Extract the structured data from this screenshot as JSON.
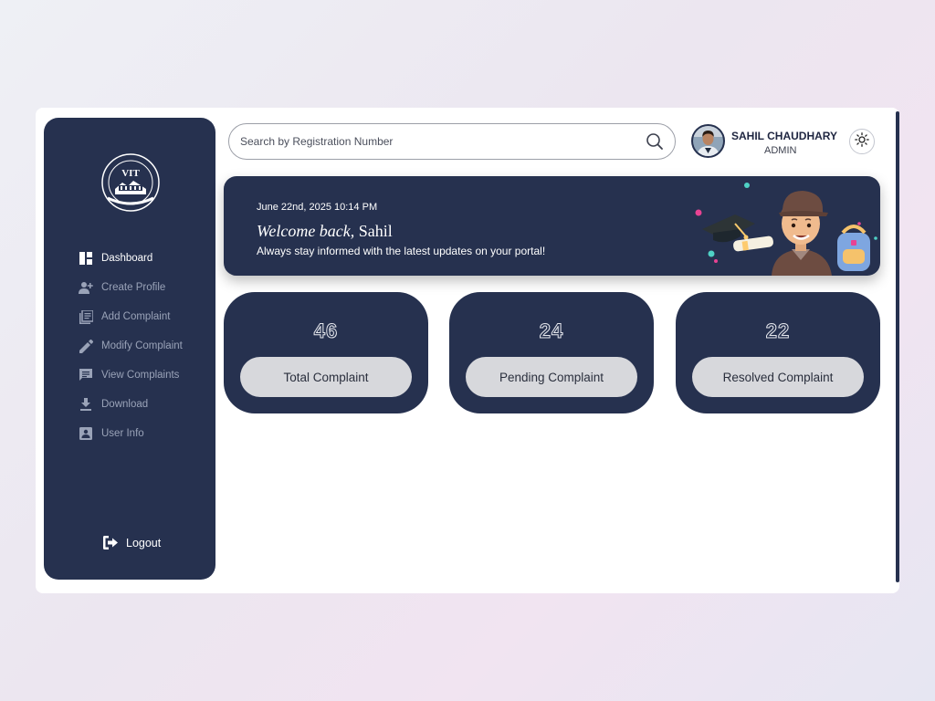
{
  "sidebar": {
    "logo_text": "VIT",
    "items": [
      {
        "label": "Dashboard",
        "icon": "dashboard-icon",
        "active": true
      },
      {
        "label": "Create Profile",
        "icon": "add-person-icon",
        "active": false
      },
      {
        "label": "Add Complaint",
        "icon": "library-add-icon",
        "active": false
      },
      {
        "label": "Modify Complaint",
        "icon": "pencil-icon",
        "active": false
      },
      {
        "label": "View Complaints",
        "icon": "message-icon",
        "active": false
      },
      {
        "label": "Download",
        "icon": "download-icon",
        "active": false
      },
      {
        "label": "User Info",
        "icon": "contact-icon",
        "active": false
      }
    ],
    "logout_label": "Logout"
  },
  "header": {
    "search_placeholder": "Search by Registration Number",
    "user_name": "SAHIL CHAUDHARY",
    "user_role": "ADMIN"
  },
  "banner": {
    "date": "June 22nd, 2025 10:14 PM",
    "welcome_prefix": "Welcome back,",
    "welcome_name": "Sahil",
    "subtitle": "Always stay informed with the latest updates on your portal!"
  },
  "stats": [
    {
      "value": "46",
      "label": "Total Complaint"
    },
    {
      "value": "24",
      "label": "Pending Complaint"
    },
    {
      "value": "22",
      "label": "Resolved Complaint"
    }
  ],
  "colors": {
    "navy": "#26314f",
    "pill": "#d7d8dc",
    "white": "#ffffff"
  }
}
